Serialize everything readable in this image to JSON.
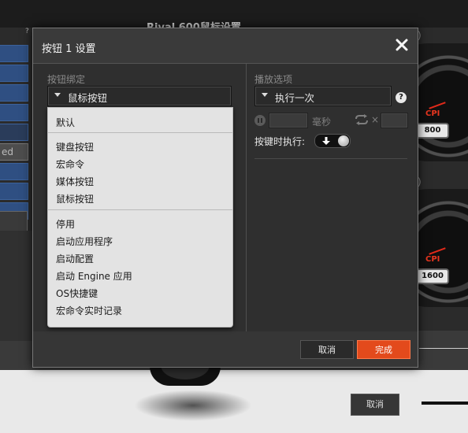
{
  "background": {
    "window_title": "Rival 600鼠标设置",
    "help_glyph": "?",
    "selected_row_text": "ed",
    "paren_top": ":)",
    "paren_bottom": ":)",
    "gauges": [
      {
        "cpi_label": "CPI",
        "value": "800"
      },
      {
        "cpi_label": "CPI",
        "value": "1600"
      }
    ],
    "cancel_label": "取消"
  },
  "dialog": {
    "title": "按钮 1 设置",
    "close_icon": "close-x-icon",
    "left": {
      "section_label": "按钮绑定",
      "select_value": "鼠标按钮",
      "dropdown_groups": [
        [
          "默认"
        ],
        [
          "键盘按钮",
          "宏命令",
          "媒体按钮",
          "鼠标按钮"
        ],
        [
          "停用",
          "启动应用程序",
          "启动配置",
          "启动 Engine 应用",
          "OS快捷键",
          "宏命令实时记录"
        ]
      ]
    },
    "right": {
      "section_label": "播放选项",
      "select_value": "执行一次",
      "help": "?",
      "delay_value": "",
      "delay_unit": "毫秒",
      "repeat_symbol": "×",
      "repeat_value": "",
      "on_press_label": "按键时执行:"
    },
    "footer": {
      "cancel_label": "取消",
      "done_label": "完成"
    },
    "colors": {
      "accent": "#e34a1c",
      "gauge_red": "#e9361f",
      "toolbar_blue": "#2f4f82"
    }
  }
}
